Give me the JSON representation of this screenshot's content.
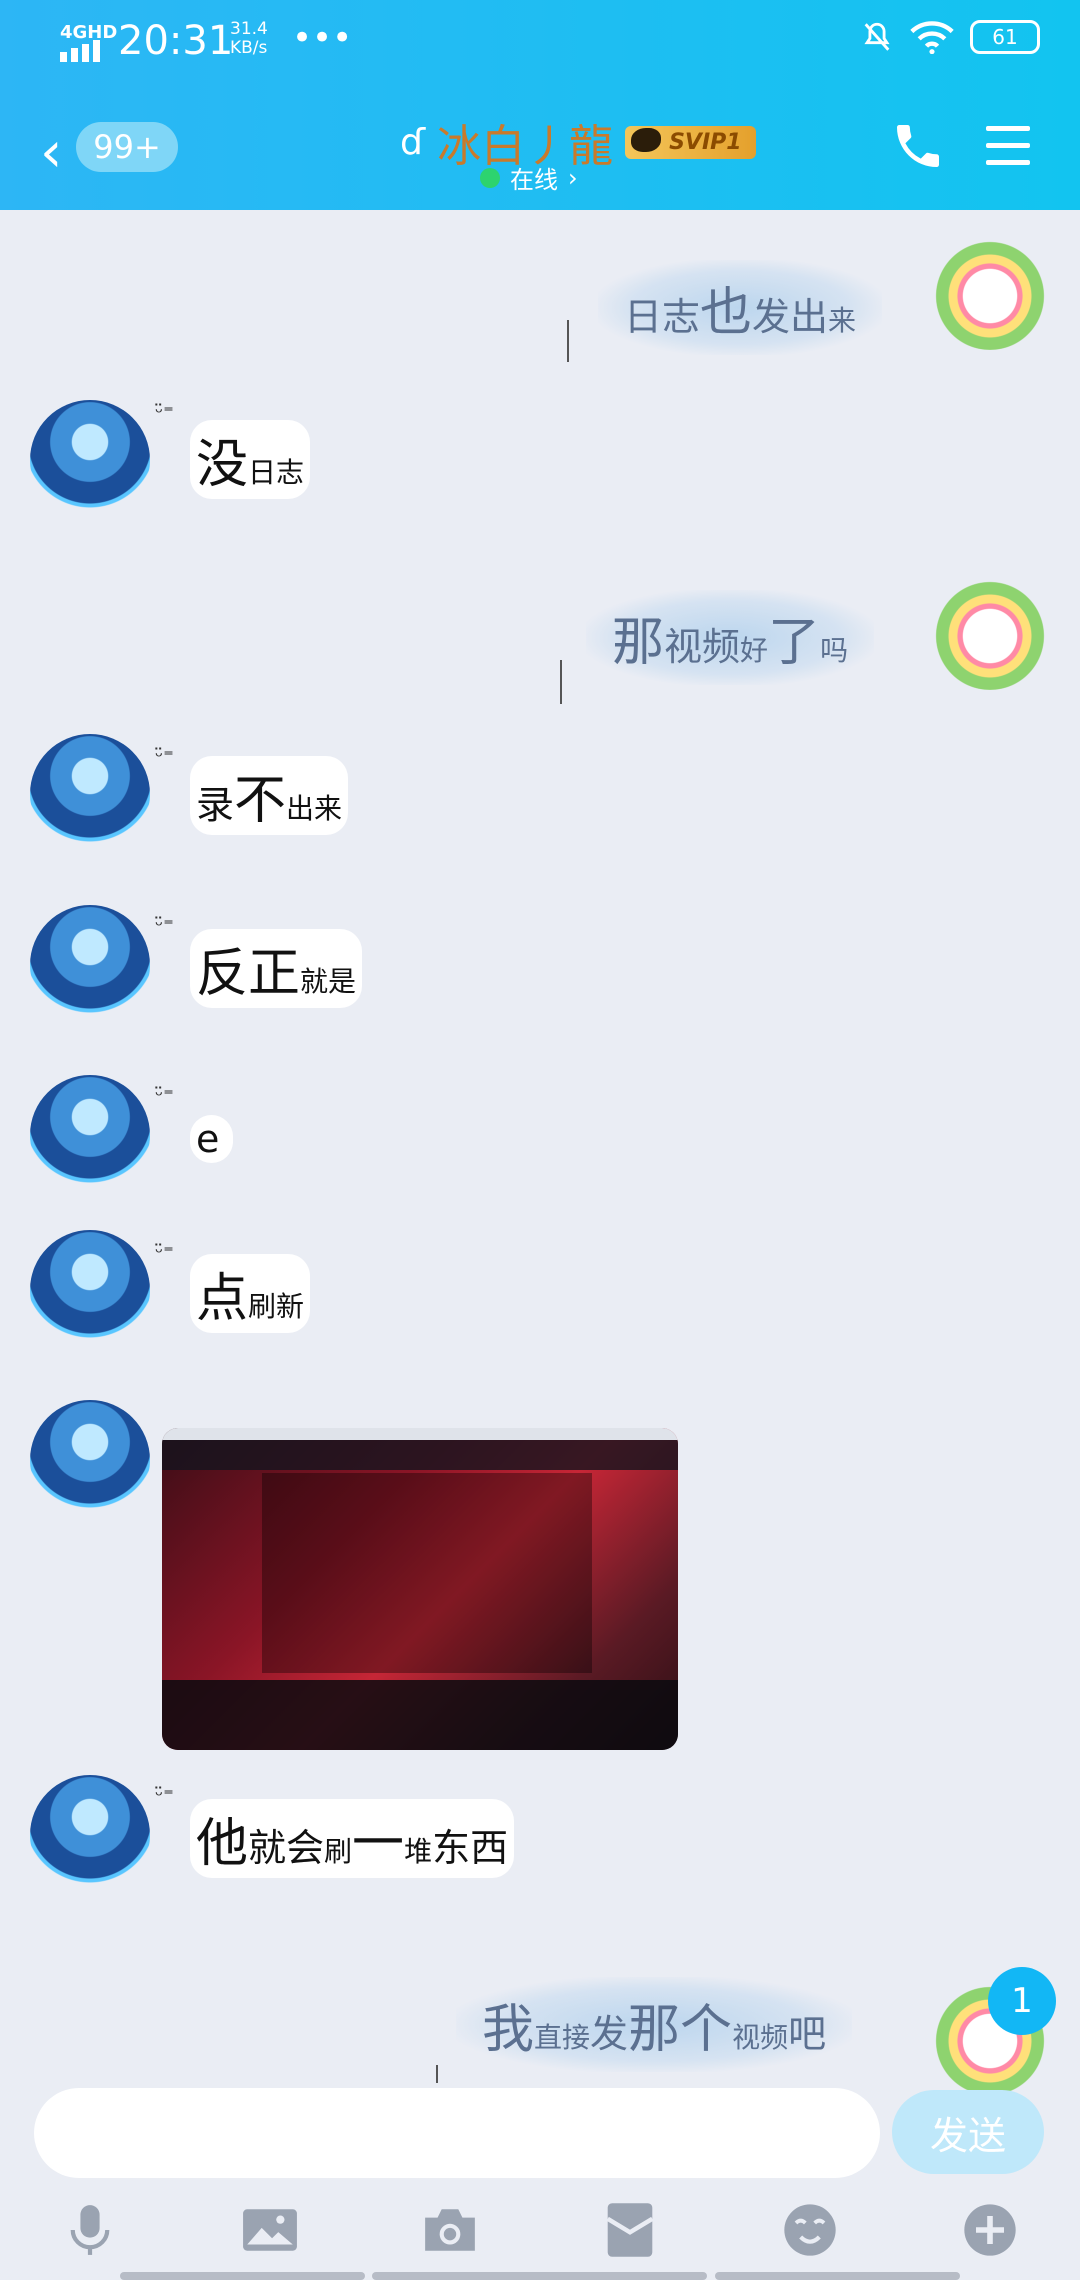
{
  "status": {
    "signal": "4GHD",
    "time": "20:31",
    "net_speed": "31.4",
    "net_unit": "KB/s",
    "more": "•••",
    "battery": "61"
  },
  "header": {
    "unread_count": "99+",
    "contact_name": "冰白丿龍",
    "vip_badge": "SVIP1",
    "presence": "在线",
    "chevron": "›"
  },
  "messages": [
    {
      "side": "right",
      "parts": [
        "日志",
        "也",
        "发出",
        "来"
      ]
    },
    {
      "side": "left",
      "kaomoji": "ᵕ̈⁼",
      "parts": [
        "没",
        "日志"
      ]
    },
    {
      "side": "right",
      "parts": [
        "那",
        "视频",
        "好",
        "了",
        "吗"
      ]
    },
    {
      "side": "left",
      "kaomoji": "ᵕ̈⁼",
      "parts": [
        "录",
        "不",
        "出来"
      ]
    },
    {
      "side": "left",
      "kaomoji": "ᵕ̈⁼",
      "parts": [
        "反正",
        "就是"
      ]
    },
    {
      "side": "left",
      "kaomoji": "ᵕ̈⁼",
      "parts": [
        "e"
      ]
    },
    {
      "side": "left",
      "kaomoji": "ᵕ̈⁼",
      "parts": [
        "点",
        "刷新"
      ]
    },
    {
      "side": "left",
      "kind": "image"
    },
    {
      "side": "left",
      "kaomoji": "ᵕ̈⁼",
      "parts": [
        "他",
        "就会",
        "刷",
        "一",
        "堆",
        "东西"
      ]
    },
    {
      "side": "right",
      "parts": [
        "我",
        "直接",
        "发",
        "那个",
        "视频",
        "吧"
      ]
    }
  ],
  "unread_bubble": "1",
  "composer": {
    "send_label": "发送",
    "placeholder": ""
  },
  "toolbar": [
    "mic-icon",
    "image-icon",
    "camera-icon",
    "red-packet-icon",
    "emoji-icon",
    "plus-icon"
  ]
}
